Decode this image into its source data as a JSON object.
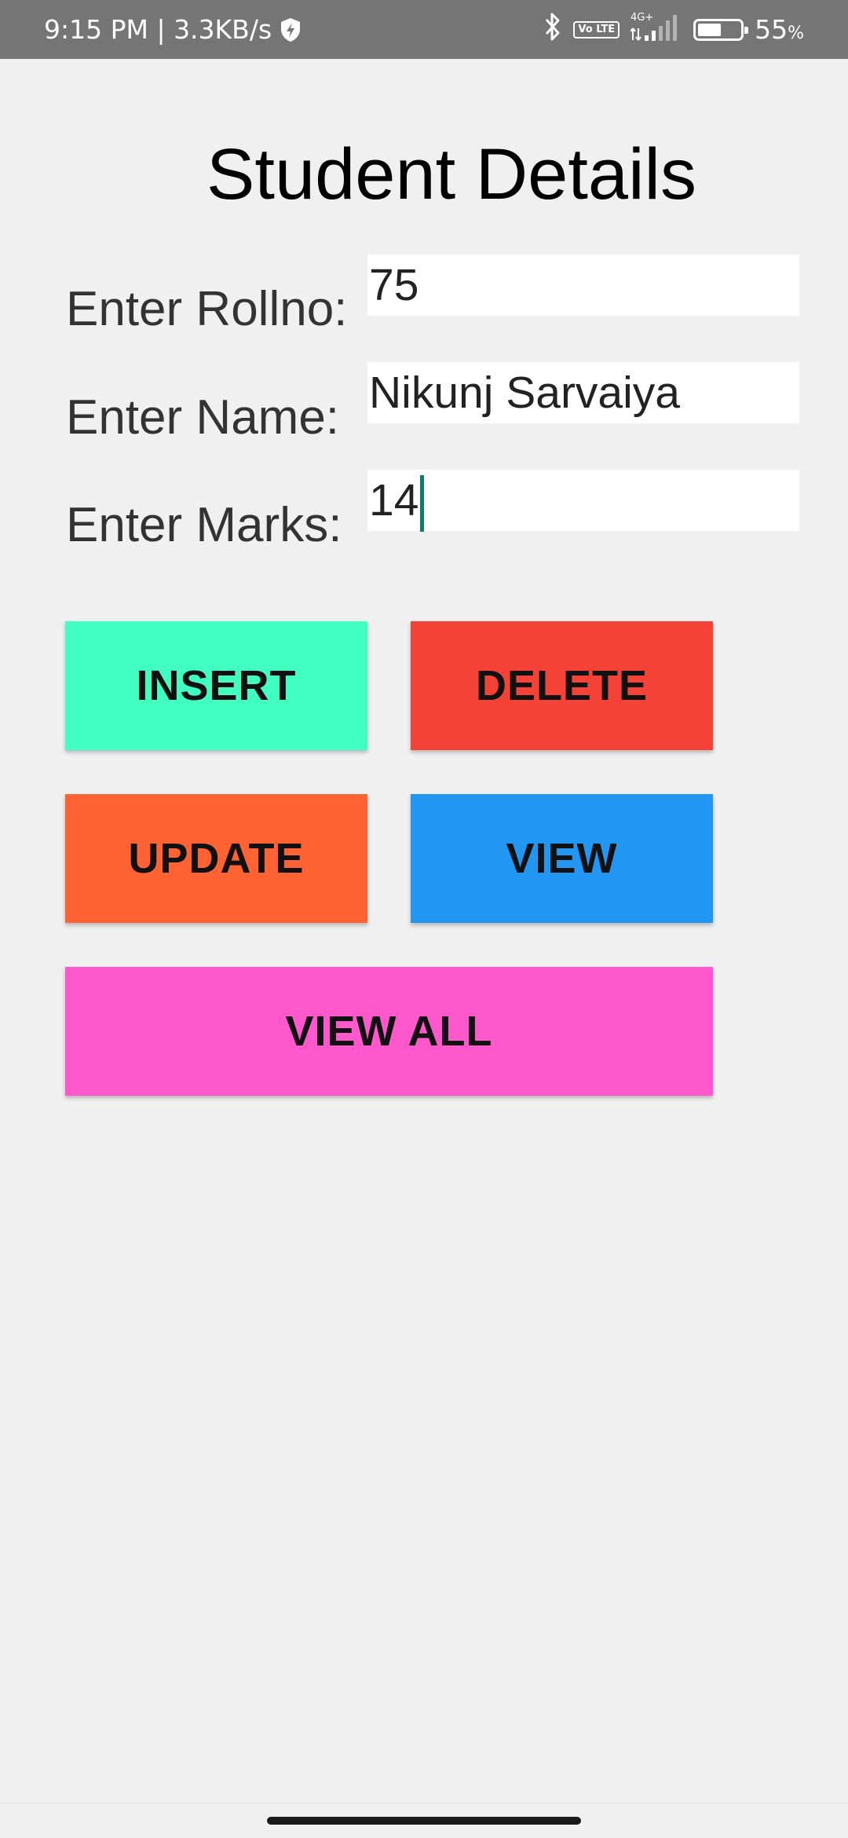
{
  "status_bar": {
    "time_speed": "9:15 PM | 3.3KB/s",
    "volte_label": "Vo LTE",
    "network_label": "4G+",
    "battery_percent": "55",
    "battery_unit": "%",
    "battery_level": 0.55,
    "icons": [
      "shield-icon",
      "bluetooth-icon",
      "volte-icon",
      "signal-icon",
      "battery-icon"
    ]
  },
  "page": {
    "title": "Student Details"
  },
  "form": {
    "rollno_label": "Enter Rollno:",
    "rollno_value": "75",
    "name_label": "Enter Name:",
    "name_value": "Nikunj Sarvaiya",
    "marks_label": "Enter Marks:",
    "marks_value": "14"
  },
  "buttons": {
    "insert": "INSERT",
    "delete": "DELETE",
    "update": "UPDATE",
    "view": "VIEW",
    "view_all": "VIEW ALL"
  },
  "colors": {
    "insert": "#40ffc0",
    "delete": "#f44336",
    "update": "#ff6333",
    "view": "#2196f3",
    "view_all": "#ff57cc",
    "background": "#f0f0f0",
    "cursor": "#0b7d6c"
  }
}
